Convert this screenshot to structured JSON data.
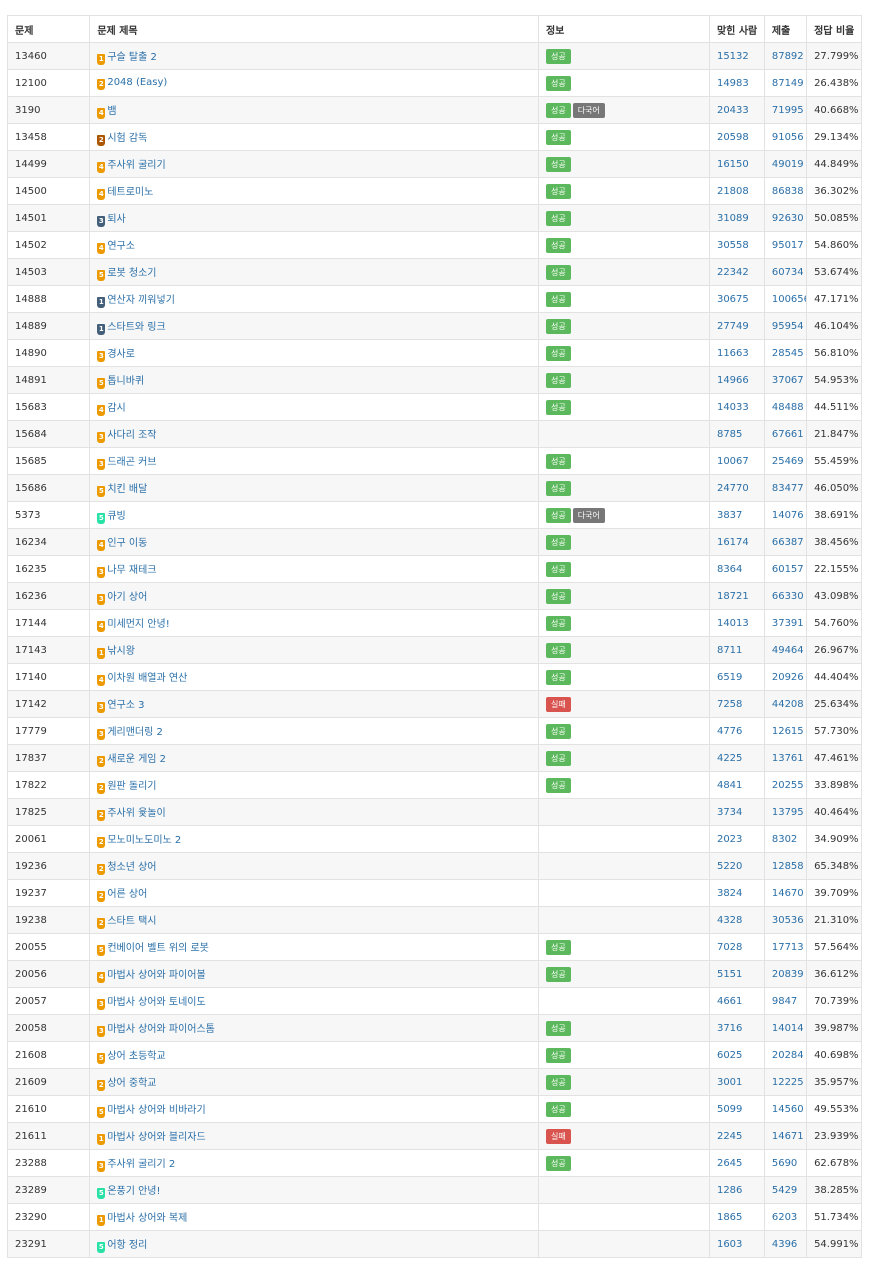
{
  "headers": {
    "id": "문제",
    "title": "문제 제목",
    "info": "정보",
    "accepted": "맞힌 사람",
    "submissions": "제출",
    "rate": "정답 비율"
  },
  "tier_colors": {
    "bronze": "#ad5600",
    "silver": "#435f7a",
    "gold": "#ec9a00",
    "platinum": "#27e2a4"
  },
  "badge_colors": {
    "성공": "#5cb85c",
    "실패": "#d9534f",
    "다국어": "#777777"
  },
  "rows": [
    {
      "id": "13460",
      "tier": "gold",
      "level": "1",
      "title": "구슬 탈출 2",
      "badges": [
        "성공"
      ],
      "accepted": "15132",
      "submissions": "87892",
      "rate": "27.799%"
    },
    {
      "id": "12100",
      "tier": "gold",
      "level": "2",
      "title": "2048 (Easy)",
      "badges": [
        "성공"
      ],
      "accepted": "14983",
      "submissions": "87149",
      "rate": "26.438%"
    },
    {
      "id": "3190",
      "tier": "gold",
      "level": "4",
      "title": "뱀",
      "badges": [
        "성공",
        "다국어"
      ],
      "accepted": "20433",
      "submissions": "71995",
      "rate": "40.668%"
    },
    {
      "id": "13458",
      "tier": "bronze",
      "level": "2",
      "title": "시험 감독",
      "badges": [
        "성공"
      ],
      "accepted": "20598",
      "submissions": "91056",
      "rate": "29.134%"
    },
    {
      "id": "14499",
      "tier": "gold",
      "level": "4",
      "title": "주사위 굴리기",
      "badges": [
        "성공"
      ],
      "accepted": "16150",
      "submissions": "49019",
      "rate": "44.849%"
    },
    {
      "id": "14500",
      "tier": "gold",
      "level": "4",
      "title": "테트로미노",
      "badges": [
        "성공"
      ],
      "accepted": "21808",
      "submissions": "86838",
      "rate": "36.302%"
    },
    {
      "id": "14501",
      "tier": "silver",
      "level": "3",
      "title": "퇴사",
      "badges": [
        "성공"
      ],
      "accepted": "31089",
      "submissions": "92630",
      "rate": "50.085%"
    },
    {
      "id": "14502",
      "tier": "gold",
      "level": "4",
      "title": "연구소",
      "badges": [
        "성공"
      ],
      "accepted": "30558",
      "submissions": "95017",
      "rate": "54.860%"
    },
    {
      "id": "14503",
      "tier": "gold",
      "level": "5",
      "title": "로봇 청소기",
      "badges": [
        "성공"
      ],
      "accepted": "22342",
      "submissions": "60734",
      "rate": "53.674%"
    },
    {
      "id": "14888",
      "tier": "silver",
      "level": "1",
      "title": "연산자 끼워넣기",
      "badges": [
        "성공"
      ],
      "accepted": "30675",
      "submissions": "100656",
      "rate": "47.171%"
    },
    {
      "id": "14889",
      "tier": "silver",
      "level": "1",
      "title": "스타트와 링크",
      "badges": [
        "성공"
      ],
      "accepted": "27749",
      "submissions": "95954",
      "rate": "46.104%"
    },
    {
      "id": "14890",
      "tier": "gold",
      "level": "3",
      "title": "경사로",
      "badges": [
        "성공"
      ],
      "accepted": "11663",
      "submissions": "28545",
      "rate": "56.810%"
    },
    {
      "id": "14891",
      "tier": "gold",
      "level": "5",
      "title": "톱니바퀴",
      "badges": [
        "성공"
      ],
      "accepted": "14966",
      "submissions": "37067",
      "rate": "54.953%"
    },
    {
      "id": "15683",
      "tier": "gold",
      "level": "4",
      "title": "감시",
      "badges": [
        "성공"
      ],
      "accepted": "14033",
      "submissions": "48488",
      "rate": "44.511%"
    },
    {
      "id": "15684",
      "tier": "gold",
      "level": "3",
      "title": "사다리 조작",
      "badges": [],
      "accepted": "8785",
      "submissions": "67661",
      "rate": "21.847%"
    },
    {
      "id": "15685",
      "tier": "gold",
      "level": "3",
      "title": "드래곤 커브",
      "badges": [
        "성공"
      ],
      "accepted": "10067",
      "submissions": "25469",
      "rate": "55.459%"
    },
    {
      "id": "15686",
      "tier": "gold",
      "level": "5",
      "title": "치킨 배달",
      "badges": [
        "성공"
      ],
      "accepted": "24770",
      "submissions": "83477",
      "rate": "46.050%"
    },
    {
      "id": "5373",
      "tier": "platinum",
      "level": "5",
      "title": "큐빙",
      "badges": [
        "성공",
        "다국어"
      ],
      "accepted": "3837",
      "submissions": "14076",
      "rate": "38.691%"
    },
    {
      "id": "16234",
      "tier": "gold",
      "level": "4",
      "title": "인구 이동",
      "badges": [
        "성공"
      ],
      "accepted": "16174",
      "submissions": "66387",
      "rate": "38.456%"
    },
    {
      "id": "16235",
      "tier": "gold",
      "level": "3",
      "title": "나무 재테크",
      "badges": [
        "성공"
      ],
      "accepted": "8364",
      "submissions": "60157",
      "rate": "22.155%"
    },
    {
      "id": "16236",
      "tier": "gold",
      "level": "3",
      "title": "아기 상어",
      "badges": [
        "성공"
      ],
      "accepted": "18721",
      "submissions": "66330",
      "rate": "43.098%"
    },
    {
      "id": "17144",
      "tier": "gold",
      "level": "4",
      "title": "미세먼지 안녕!",
      "badges": [
        "성공"
      ],
      "accepted": "14013",
      "submissions": "37391",
      "rate": "54.760%"
    },
    {
      "id": "17143",
      "tier": "gold",
      "level": "1",
      "title": "낚시왕",
      "badges": [
        "성공"
      ],
      "accepted": "8711",
      "submissions": "49464",
      "rate": "26.967%"
    },
    {
      "id": "17140",
      "tier": "gold",
      "level": "4",
      "title": "이차원 배열과 연산",
      "badges": [
        "성공"
      ],
      "accepted": "6519",
      "submissions": "20926",
      "rate": "44.404%"
    },
    {
      "id": "17142",
      "tier": "gold",
      "level": "3",
      "title": "연구소 3",
      "badges": [
        "실패"
      ],
      "accepted": "7258",
      "submissions": "44208",
      "rate": "25.634%"
    },
    {
      "id": "17779",
      "tier": "gold",
      "level": "3",
      "title": "게리맨더링 2",
      "badges": [
        "성공"
      ],
      "accepted": "4776",
      "submissions": "12615",
      "rate": "57.730%"
    },
    {
      "id": "17837",
      "tier": "gold",
      "level": "2",
      "title": "새로운 게임 2",
      "badges": [
        "성공"
      ],
      "accepted": "4225",
      "submissions": "13761",
      "rate": "47.461%"
    },
    {
      "id": "17822",
      "tier": "gold",
      "level": "2",
      "title": "원판 돌리기",
      "badges": [
        "성공"
      ],
      "accepted": "4841",
      "submissions": "20255",
      "rate": "33.898%"
    },
    {
      "id": "17825",
      "tier": "gold",
      "level": "2",
      "title": "주사위 윷놀이",
      "badges": [],
      "accepted": "3734",
      "submissions": "13795",
      "rate": "40.464%"
    },
    {
      "id": "20061",
      "tier": "gold",
      "level": "2",
      "title": "모노미노도미노 2",
      "badges": [],
      "accepted": "2023",
      "submissions": "8302",
      "rate": "34.909%"
    },
    {
      "id": "19236",
      "tier": "gold",
      "level": "2",
      "title": "청소년 상어",
      "badges": [],
      "accepted": "5220",
      "submissions": "12858",
      "rate": "65.348%"
    },
    {
      "id": "19237",
      "tier": "gold",
      "level": "2",
      "title": "어른 상어",
      "badges": [],
      "accepted": "3824",
      "submissions": "14670",
      "rate": "39.709%"
    },
    {
      "id": "19238",
      "tier": "gold",
      "level": "2",
      "title": "스타트 택시",
      "badges": [],
      "accepted": "4328",
      "submissions": "30536",
      "rate": "21.310%"
    },
    {
      "id": "20055",
      "tier": "gold",
      "level": "5",
      "title": "컨베이어 벨트 위의 로봇",
      "badges": [
        "성공"
      ],
      "accepted": "7028",
      "submissions": "17713",
      "rate": "57.564%"
    },
    {
      "id": "20056",
      "tier": "gold",
      "level": "4",
      "title": "마법사 상어와 파이어볼",
      "badges": [
        "성공"
      ],
      "accepted": "5151",
      "submissions": "20839",
      "rate": "36.612%"
    },
    {
      "id": "20057",
      "tier": "gold",
      "level": "3",
      "title": "마법사 상어와 토네이도",
      "badges": [],
      "accepted": "4661",
      "submissions": "9847",
      "rate": "70.739%"
    },
    {
      "id": "20058",
      "tier": "gold",
      "level": "3",
      "title": "마법사 상어와 파이어스톰",
      "badges": [
        "성공"
      ],
      "accepted": "3716",
      "submissions": "14014",
      "rate": "39.987%"
    },
    {
      "id": "21608",
      "tier": "gold",
      "level": "5",
      "title": "상어 초등학교",
      "badges": [
        "성공"
      ],
      "accepted": "6025",
      "submissions": "20284",
      "rate": "40.698%"
    },
    {
      "id": "21609",
      "tier": "gold",
      "level": "2",
      "title": "상어 중학교",
      "badges": [
        "성공"
      ],
      "accepted": "3001",
      "submissions": "12225",
      "rate": "35.957%"
    },
    {
      "id": "21610",
      "tier": "gold",
      "level": "5",
      "title": "마법사 상어와 비바라기",
      "badges": [
        "성공"
      ],
      "accepted": "5099",
      "submissions": "14560",
      "rate": "49.553%"
    },
    {
      "id": "21611",
      "tier": "gold",
      "level": "1",
      "title": "마법사 상어와 블리자드",
      "badges": [
        "실패"
      ],
      "accepted": "2245",
      "submissions": "14671",
      "rate": "23.939%"
    },
    {
      "id": "23288",
      "tier": "gold",
      "level": "3",
      "title": "주사위 굴리기 2",
      "badges": [
        "성공"
      ],
      "accepted": "2645",
      "submissions": "5690",
      "rate": "62.678%"
    },
    {
      "id": "23289",
      "tier": "platinum",
      "level": "5",
      "title": "온풍기 안녕!",
      "badges": [],
      "accepted": "1286",
      "submissions": "5429",
      "rate": "38.285%"
    },
    {
      "id": "23290",
      "tier": "gold",
      "level": "1",
      "title": "마법사 상어와 복제",
      "badges": [],
      "accepted": "1865",
      "submissions": "6203",
      "rate": "51.734%"
    },
    {
      "id": "23291",
      "tier": "platinum",
      "level": "5",
      "title": "어항 정리",
      "badges": [],
      "accepted": "1603",
      "submissions": "4396",
      "rate": "54.991%"
    }
  ]
}
